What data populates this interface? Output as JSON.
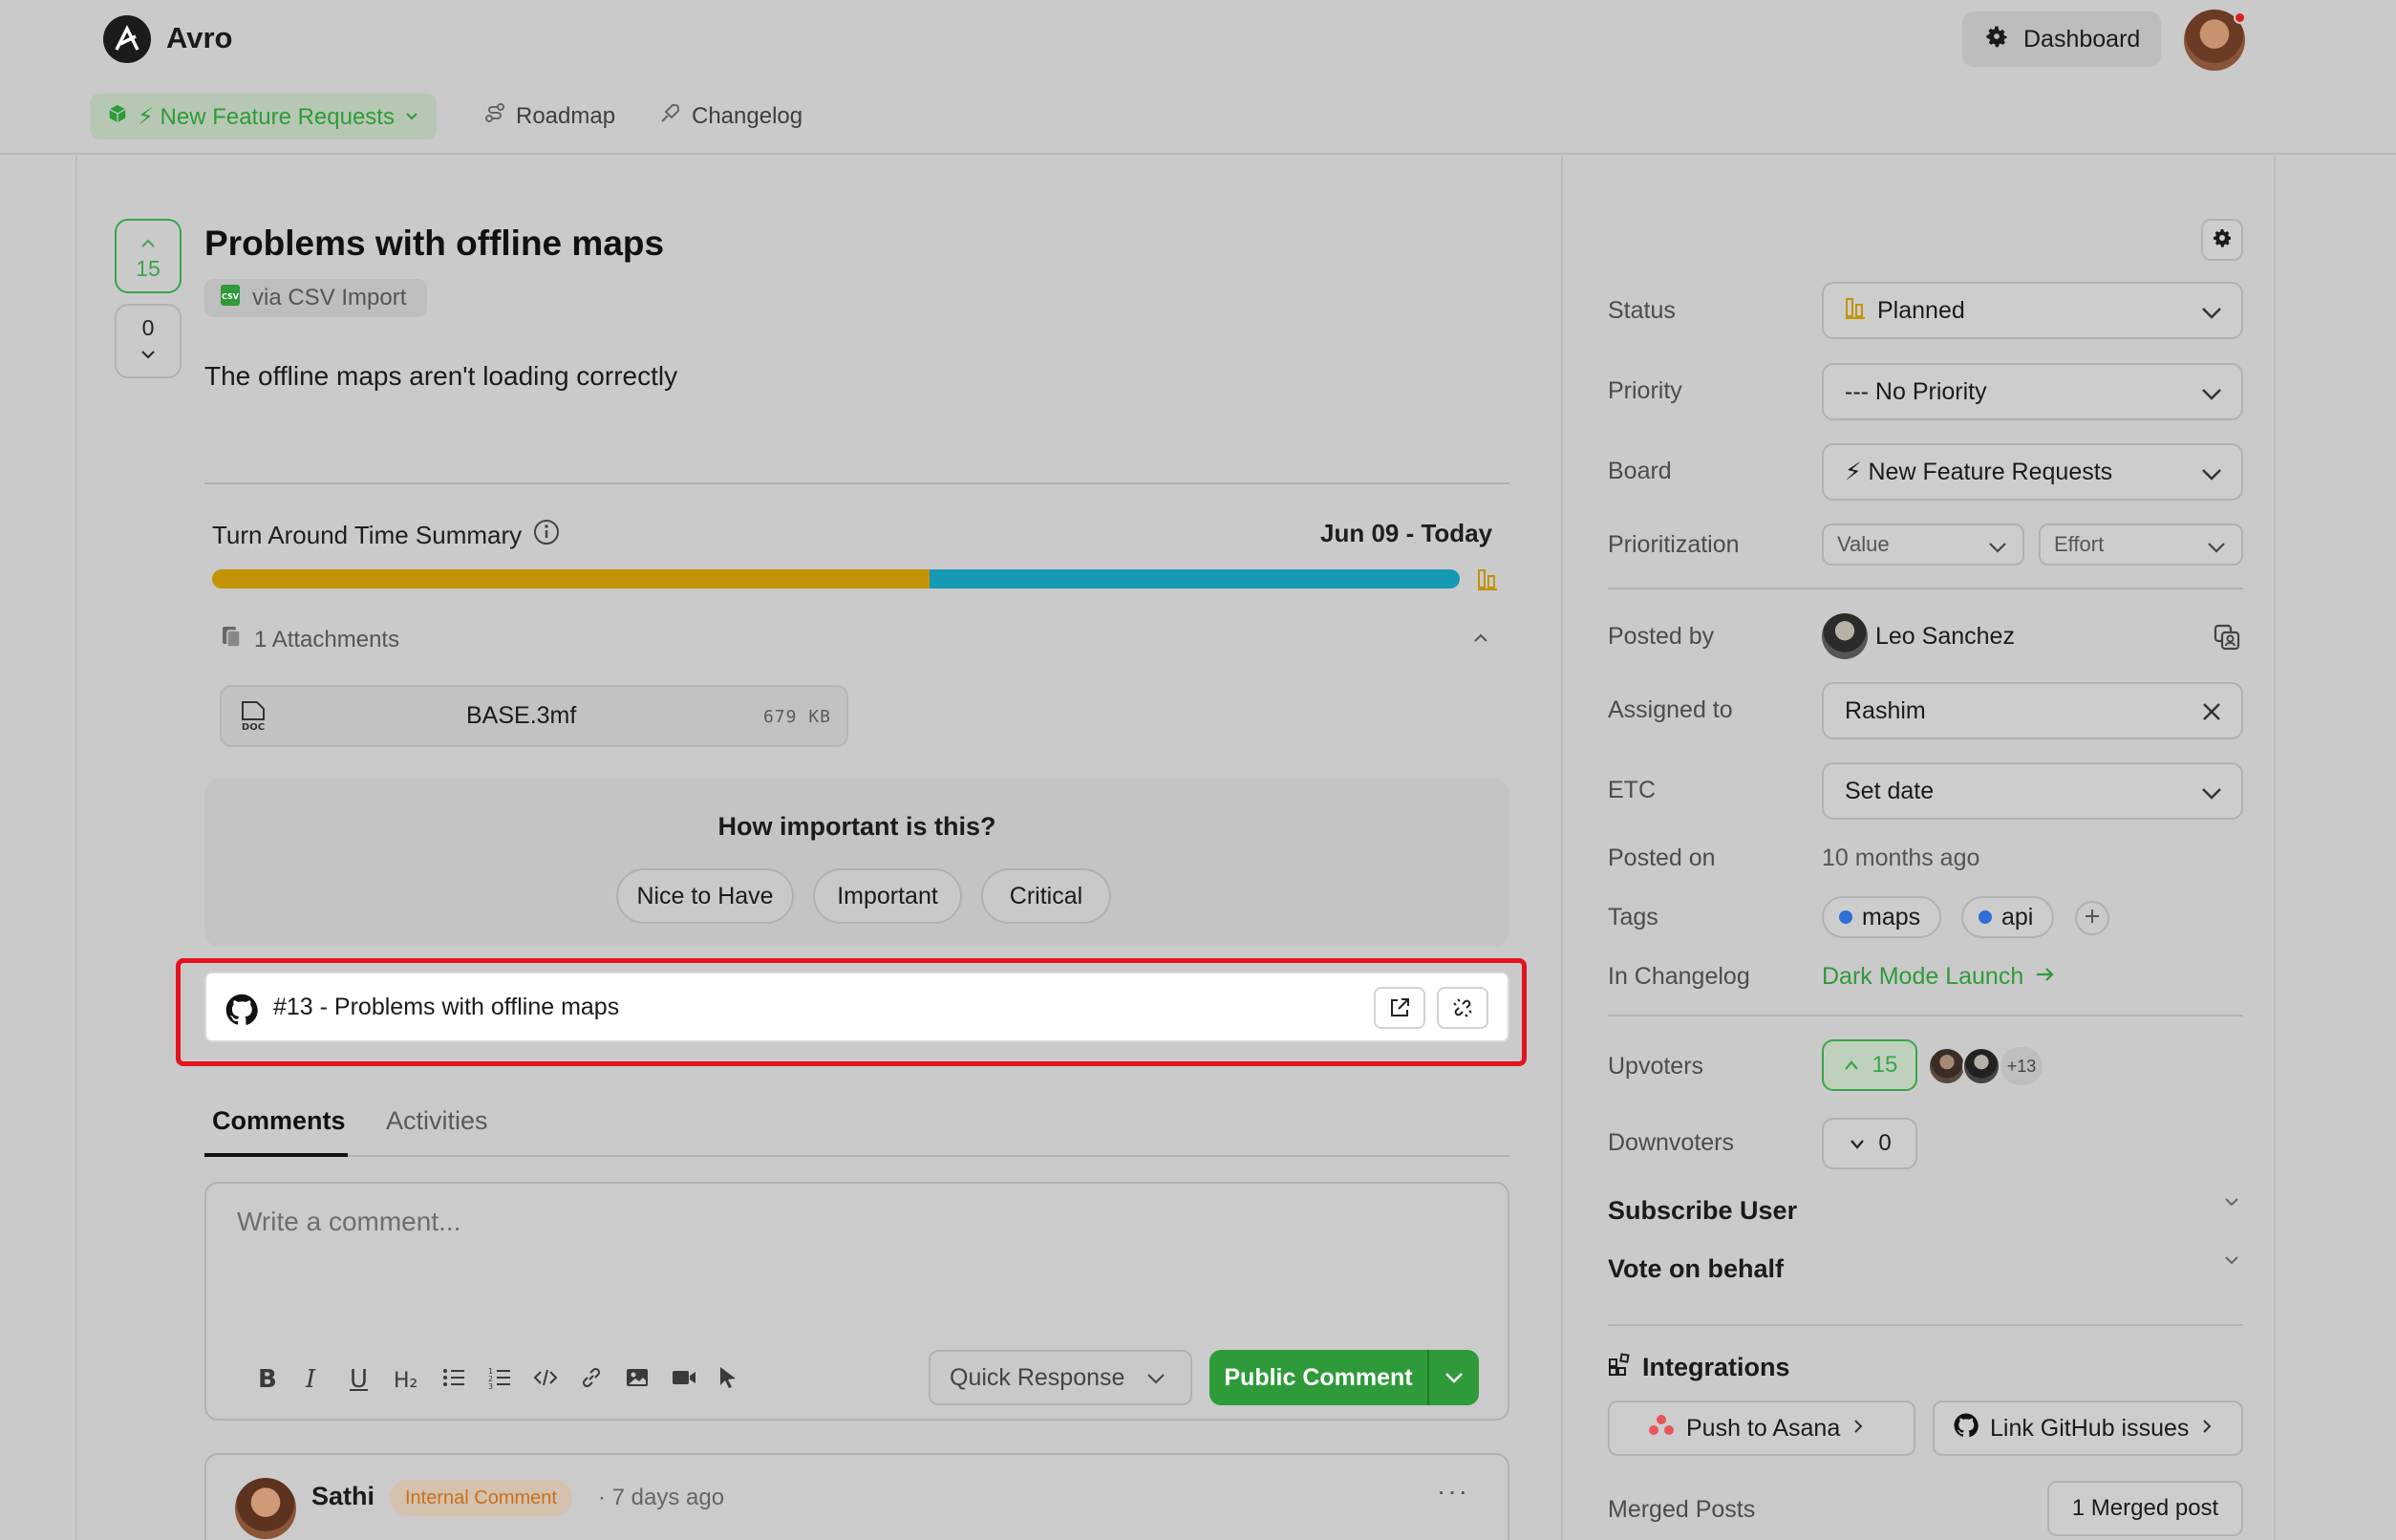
{
  "app": {
    "name": "Avro"
  },
  "header": {
    "dashboard_label": "Dashboard",
    "nav": {
      "board_label": "⚡ New Feature Requests",
      "roadmap_label": "Roadmap",
      "changelog_label": "Changelog"
    }
  },
  "post": {
    "upvotes": "15",
    "downvotes": "0",
    "title": "Problems with offline maps",
    "source": "via CSV Import",
    "body": "The offline maps aren't loading correctly"
  },
  "turnaround": {
    "title": "Turn Around Time Summary",
    "range": "Jun 09 - Today",
    "segments": [
      {
        "fraction": 0.575,
        "color": "#c29405"
      },
      {
        "fraction": 0.425,
        "color": "#1599b4"
      }
    ]
  },
  "attachments": {
    "heading": "1 Attachments",
    "files": [
      {
        "name": "BASE.3mf",
        "size": "679 KB",
        "type_label": "DOC"
      }
    ]
  },
  "importance": {
    "question": "How important is this?",
    "options": [
      "Nice to Have",
      "Important",
      "Critical"
    ]
  },
  "github_link": {
    "text": "#13 - Problems with offline maps"
  },
  "tabs": {
    "comments": "Comments",
    "activities": "Activities"
  },
  "composer": {
    "placeholder": "Write a comment...",
    "quick_response": "Quick Response",
    "public_comment": "Public Comment"
  },
  "comment": {
    "author": "Sathi",
    "badge": "Internal Comment",
    "time": "· 7 days ago",
    "more": "···"
  },
  "sidebar": {
    "status_label": "Status",
    "status_value": "Planned",
    "priority_label": "Priority",
    "priority_value": "--- No Priority",
    "board_label": "Board",
    "board_value": "⚡ New Feature Requests",
    "prioritization_label": "Prioritization",
    "value_label": "Value",
    "effort_label": "Effort",
    "posted_by_label": "Posted by",
    "posted_by_value": "Leo Sanchez",
    "assigned_label": "Assigned to",
    "assigned_value": "Rashim",
    "etc_label": "ETC",
    "etc_value": "Set date",
    "posted_on_label": "Posted on",
    "posted_on_value": "10 months ago",
    "tags_label": "Tags",
    "tags": [
      "maps",
      "api"
    ],
    "changelog_label": "In Changelog",
    "changelog_value": "Dark Mode Launch",
    "upvoters_label": "Upvoters",
    "upvoters_count": "15",
    "upvoters_more": "+13",
    "downvoters_label": "Downvoters",
    "downvoters_count": "0",
    "subscribe_label": "Subscribe User",
    "vote_behalf_label": "Vote on behalf",
    "integrations_label": "Integrations",
    "push_asana": "Push to Asana",
    "link_github": "Link GitHub issues",
    "merged_label": "Merged Posts",
    "merged_value": "1 Merged post"
  },
  "colors": {
    "accent_green": "#2f9a3a",
    "highlight_red": "#e3131f",
    "status_yellow": "#c29405",
    "tag_blue": "#2f6fd6",
    "badge_orange": "#c8701a"
  }
}
